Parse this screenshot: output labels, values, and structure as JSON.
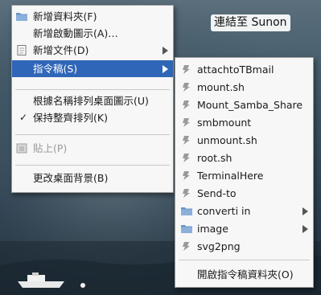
{
  "desktop": {
    "shortcut_label": "連結至 Sunon"
  },
  "main_menu": {
    "new_folder": "新增資料夾(F)",
    "new_launcher": "新增啟動圖示(A)…",
    "new_document": "新增文件(D)",
    "scripts": "指令稿(S)",
    "sort_by_name": "根據名稱排列桌面圖示(U)",
    "keep_aligned": "保持整齊排列(K)",
    "paste": "貼上(P)",
    "change_background": "更改桌面背景(B)",
    "check_mark": "✓"
  },
  "scripts_menu": {
    "items": [
      {
        "label": "attachtoTBmail",
        "icon": "script-icon"
      },
      {
        "label": "mount.sh",
        "icon": "script-icon"
      },
      {
        "label": "Mount_Samba_Share",
        "icon": "script-icon"
      },
      {
        "label": "smbmount",
        "icon": "script-icon"
      },
      {
        "label": "unmount.sh",
        "icon": "script-icon"
      },
      {
        "label": "root.sh",
        "icon": "script-icon"
      },
      {
        "label": "TerminalHere",
        "icon": "script-icon"
      },
      {
        "label": "Send-to",
        "icon": "script-icon"
      },
      {
        "label": "converti in",
        "icon": "folder-icon"
      },
      {
        "label": "image",
        "icon": "folder-icon"
      },
      {
        "label": "svg2png",
        "icon": "script-icon"
      }
    ],
    "open_scripts_folder": "開啟指令稿資料夾(O)"
  },
  "colors": {
    "highlight": "#2f66b7",
    "folder": "#6b93c4"
  }
}
